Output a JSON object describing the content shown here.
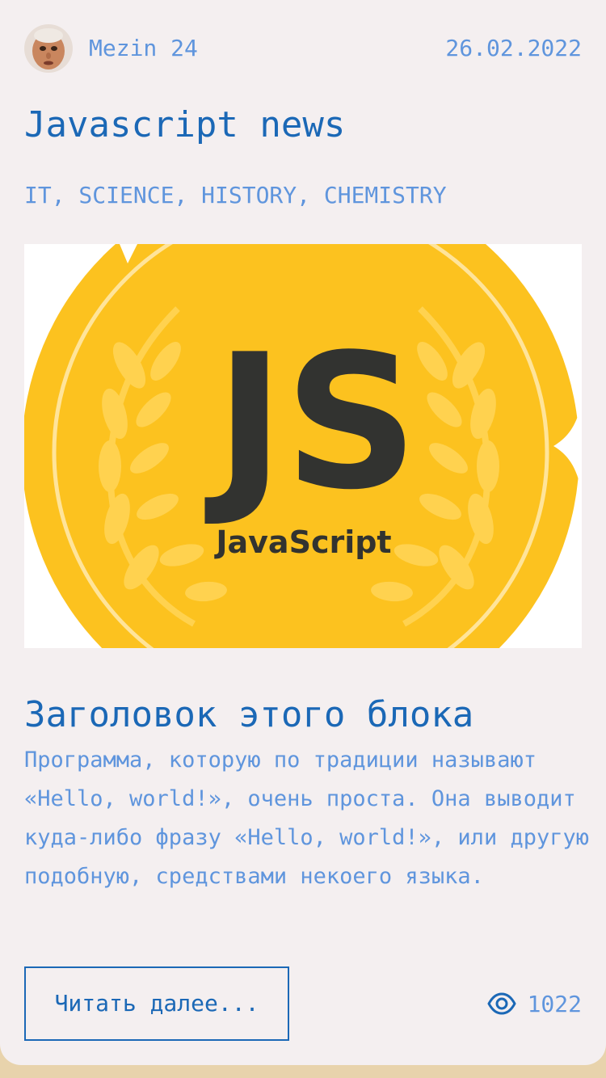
{
  "post": {
    "author": "Mezin 24",
    "date": "26.02.2022",
    "title": "Javascript news",
    "tags": "IT, SCIENCE, HISTORY, CHEMISTRY",
    "image": {
      "logo_text": "JS",
      "caption": "JavaScript"
    },
    "block_title": "Заголовок этого блока",
    "block_text": "Программа, которую по традиции называют «Hello, world!», очень проста. Она выводит куда-либо фразу «Hello, world!», или другую подобную, средствами некоего языка.",
    "read_more_label": "Читать далее...",
    "views": "1022",
    "views_icon": "eye-icon"
  },
  "colors": {
    "title": "#1b68b6",
    "accent_text": "#5f95dd",
    "card_background": "#f4eff0",
    "page_background": "#e8d3ac",
    "badge_yellow": "#fcc21f"
  }
}
